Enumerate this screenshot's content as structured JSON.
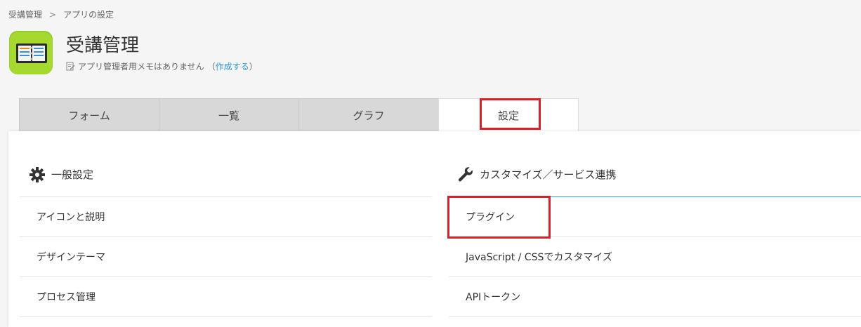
{
  "breadcrumb": {
    "items": [
      "受講管理",
      "アプリの設定"
    ],
    "separator": ">"
  },
  "app": {
    "title": "受講管理",
    "memo_text": "アプリ管理者用メモはありません",
    "memo_open": "（",
    "memo_link": "作成する",
    "memo_close": "）"
  },
  "tabs": [
    {
      "label": "フォーム"
    },
    {
      "label": "一覧"
    },
    {
      "label": "グラフ"
    },
    {
      "label": "設定"
    }
  ],
  "general": {
    "title": "一般設定",
    "items": [
      "アイコンと説明",
      "デザインテーマ",
      "プロセス管理"
    ]
  },
  "custom": {
    "title": "カスタマイズ／サービス連携",
    "items": [
      "プラグイン",
      "JavaScript / CSSでカスタマイズ",
      "APIトークン"
    ]
  },
  "colors": {
    "accent": "#3498db",
    "highlight": "#d9202a",
    "icon_bg": "#a6d92f"
  }
}
